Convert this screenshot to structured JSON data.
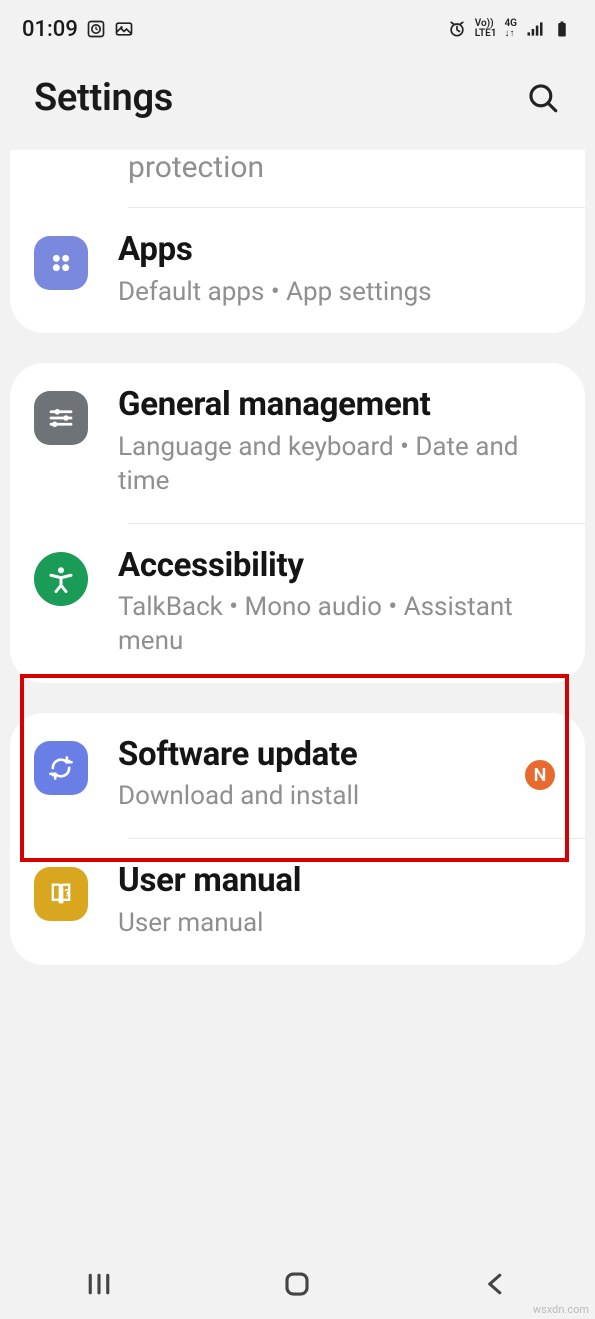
{
  "status": {
    "time": "01:09"
  },
  "header": {
    "title": "Settings"
  },
  "partial": {
    "text": "protection"
  },
  "apps": {
    "title": "Apps",
    "sub": "Default apps  •  App settings"
  },
  "general": {
    "title": "General management",
    "sub": "Language and keyboard  •  Date and time"
  },
  "accessibility": {
    "title": "Accessibility",
    "sub": "TalkBack  •  Mono audio  •  Assistant menu"
  },
  "software": {
    "title": "Software update",
    "sub": "Download and install",
    "badge": "N"
  },
  "manual": {
    "title": "User manual",
    "sub": "User manual"
  },
  "watermark": "wsxdn.com"
}
